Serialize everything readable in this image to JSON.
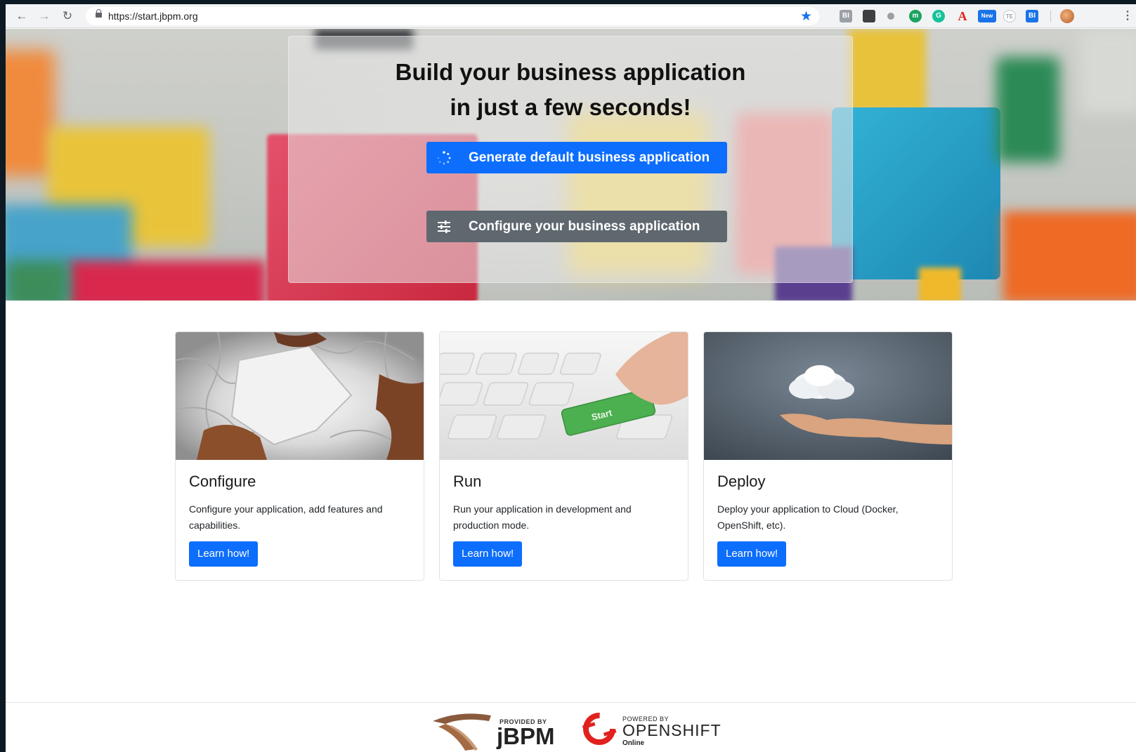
{
  "browser": {
    "url": "https://start.jbpm.org",
    "extensions": [
      {
        "icon": "extension-bi-icon",
        "glyph": "BI",
        "color": "#9aa0a6"
      },
      {
        "icon": "extension-pin-icon",
        "glyph": "",
        "color": "#3c4043"
      },
      {
        "icon": "extension-dot-icon",
        "glyph": "",
        "color": "#9aa0a6"
      },
      {
        "icon": "extension-m-icon",
        "glyph": "m",
        "color": "#1aa260"
      },
      {
        "icon": "extension-grammarly-icon",
        "glyph": "G",
        "color": "#15c39a"
      },
      {
        "icon": "extension-acrobat-icon",
        "glyph": "A",
        "color": "#e2231a"
      },
      {
        "icon": "extension-new-icon",
        "glyph": "New",
        "color": "#1a73e8"
      },
      {
        "icon": "extension-te-icon",
        "glyph": "TE",
        "color": "#c6c8cb"
      },
      {
        "icon": "extension-bi2-icon",
        "glyph": "BI",
        "color": "#1a73e8"
      }
    ]
  },
  "hero": {
    "title_line1": "Build your business application",
    "title_line2": "in just a few seconds!",
    "generate_label": "Generate default business application",
    "configure_label": "Configure your business application"
  },
  "cards": [
    {
      "title": "Configure",
      "text": "Configure your application, add features and capabilities.",
      "button": "Learn how!"
    },
    {
      "title": "Run",
      "text": "Run your application in development and production mode.",
      "button": "Learn how!",
      "key_label": "Start"
    },
    {
      "title": "Deploy",
      "text": "Deploy your application to Cloud (Docker, OpenShift, etc).",
      "button": "Learn how!"
    }
  ],
  "footer": {
    "jbpm_provided": "PROVIDED BY",
    "jbpm_name": "jBPM",
    "openshift_powered": "POWERED BY",
    "openshift_name": "OPENSHIFT",
    "openshift_online": "Online"
  },
  "colors": {
    "primary": "#0d6efd",
    "secondary": "#5f676f"
  }
}
